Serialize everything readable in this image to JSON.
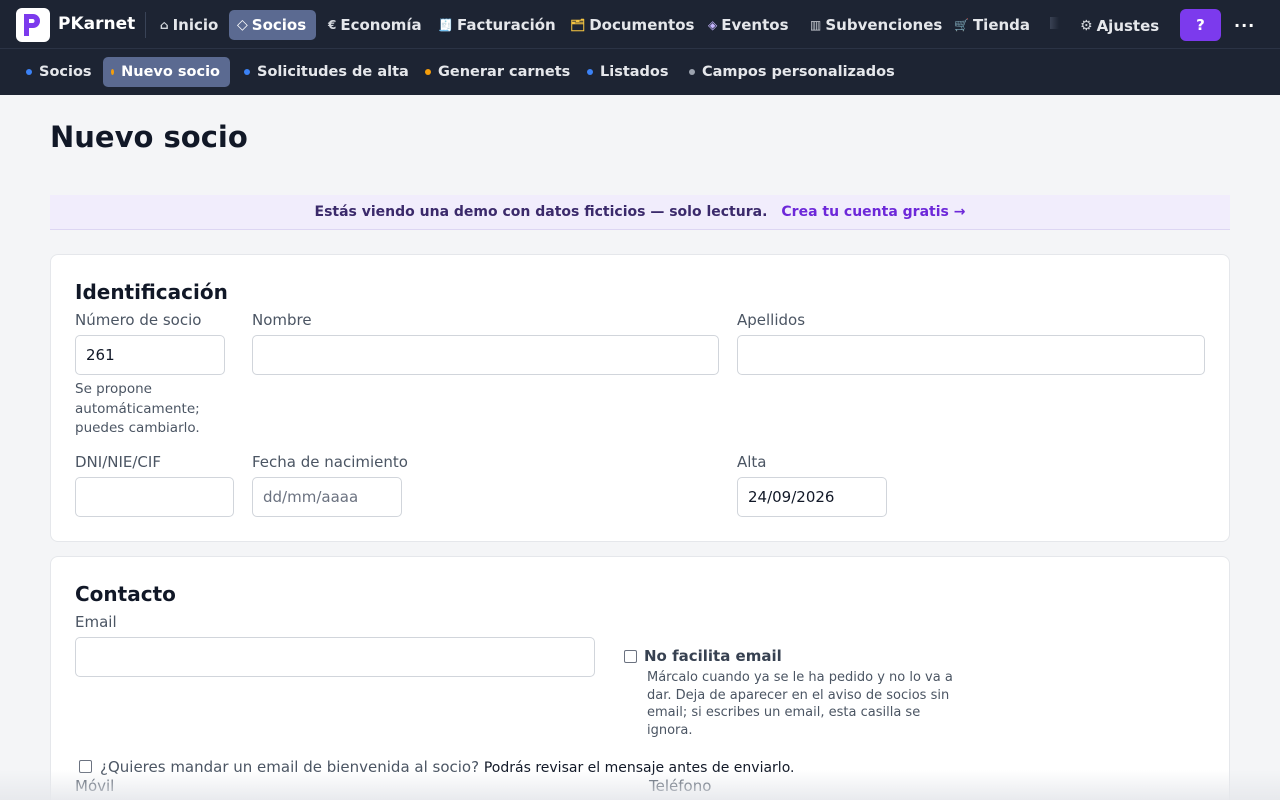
{
  "app": {
    "brand": "PKarnet"
  },
  "topnav": {
    "items": [
      {
        "label": "Inicio",
        "icon": "home-icon",
        "glyph": "⌂"
      },
      {
        "label": "Socios",
        "icon": "diamond-icon",
        "glyph": "◇"
      },
      {
        "label": "Economía",
        "icon": "euro-icon",
        "glyph": "€"
      },
      {
        "label": "Facturación",
        "icon": "invoice-icon",
        "glyph": "🧾"
      },
      {
        "label": "Documentos",
        "icon": "folder-icon",
        "glyph": "🗂"
      },
      {
        "label": "Eventos",
        "icon": "event-diamond-icon",
        "glyph": "◈"
      },
      {
        "label": "Subvenciones",
        "icon": "columns-icon",
        "glyph": "▥"
      },
      {
        "label": "Tienda",
        "icon": "cart-icon",
        "glyph": "🛒"
      },
      {
        "label": "Ajustes",
        "icon": "gear-icon",
        "glyph": "⚙"
      }
    ],
    "help_label": "?",
    "more_label": "..."
  },
  "subnav": {
    "items": [
      {
        "label": "Socios",
        "dot_color": "#3b82f6"
      },
      {
        "label": "Nuevo socio",
        "dot_color": "#f59e0b"
      },
      {
        "label": "Solicitudes de alta",
        "dot_color": "#3b82f6"
      },
      {
        "label": "Generar carnets",
        "dot_color": "#f59e0b"
      },
      {
        "label": "Listados",
        "dot_color": "#3b82f6"
      },
      {
        "label": "Campos personalizados",
        "dot_color": "#9ca3af"
      }
    ]
  },
  "page": {
    "title": "Nuevo socio"
  },
  "banner": {
    "text": "Estás viendo una demo con datos ficticios — solo lectura.",
    "link": "Crea tu cuenta gratis →"
  },
  "identificacion": {
    "title": "Identificación",
    "numero_label": "Número de socio",
    "numero_value": "261",
    "numero_hint": "Se propone automáticamente; puedes cambiarlo.",
    "nombre_label": "Nombre",
    "nombre_value": "",
    "apellidos_label": "Apellidos",
    "apellidos_value": "",
    "dni_label": "DNI/NIE/CIF",
    "dni_value": "",
    "fecha_label": "Fecha de nacimiento",
    "fecha_placeholder": "dd/mm/aaaa",
    "alta_label": "Alta",
    "alta_value": "24/09/2026"
  },
  "contacto": {
    "title": "Contacto",
    "email_label": "Email",
    "email_value": "",
    "no_email_label": "No facilita email",
    "no_email_hint": "Márcalo cuando ya se le ha pedido y no lo va a dar. Deja de aparecer en el aviso de socios sin email; si escribes un email, esta casilla se ignora.",
    "welcome_label": "¿Quieres mandar un email de bienvenida al socio?",
    "welcome_hint": "Podrás revisar el mensaje antes de enviarlo.",
    "movil_label": "Móvil",
    "telefono_label": "Teléfono"
  },
  "colors": {
    "nav_bg": "#1d2433",
    "active_bg": "#5b6a91",
    "accent": "#7c3aed",
    "banner_bg": "#f1edfc"
  }
}
